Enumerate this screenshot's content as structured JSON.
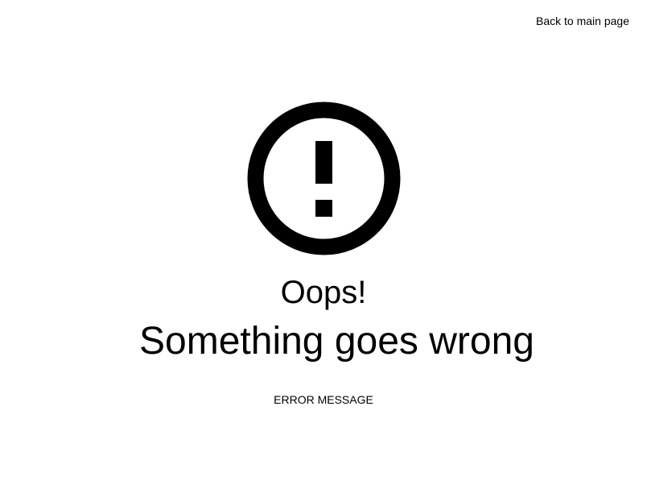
{
  "header": {
    "back_link_label": "Back to main page"
  },
  "alert": {
    "icon": "exclamation-circle-icon",
    "color": "#000000"
  },
  "main": {
    "oops_text": "Oops!",
    "headline": "Something goes wrong",
    "error_message": "ERROR MESSAGE"
  }
}
